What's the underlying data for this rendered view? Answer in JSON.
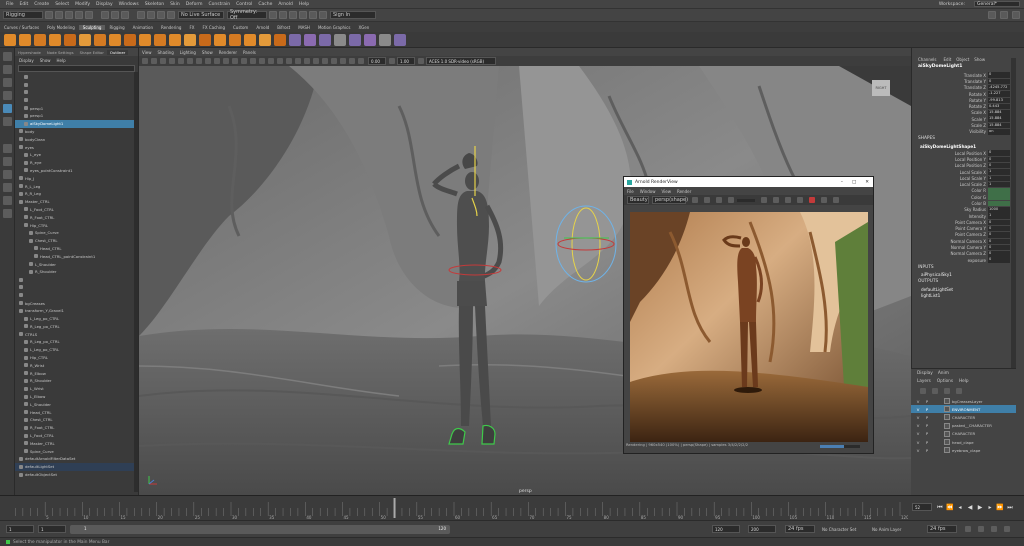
{
  "menu": {
    "items": [
      "File",
      "Edit",
      "Create",
      "Select",
      "Modify",
      "Display",
      "Windows",
      "Skeleton",
      "Skin",
      "Deform",
      "Constrain",
      "Control",
      "Cache",
      "Arnold",
      "Help"
    ],
    "workspace_label": "Workspace:",
    "workspace_value": "General*"
  },
  "statusline": {
    "mode": "Rigging",
    "live_surface": "No Live Surface",
    "symmetry": "Symmetry: Off",
    "signin": "Sign In"
  },
  "shelf_tabs": [
    "Curves / Surfaces",
    "Poly Modeling",
    "Sculpting",
    "Rigging",
    "Animation",
    "Rendering",
    "FX",
    "FX Caching",
    "Custom",
    "Arnold",
    "Bifrost",
    "MASH",
    "Motion Graphics",
    "XGen"
  ],
  "shelf_active": "Sculpting",
  "outliner": {
    "tabs": [
      "Hypershade",
      "Node Settings",
      "Shape Editor",
      "Outliner"
    ],
    "menu": [
      "Display",
      "Show",
      "Help"
    ],
    "search_placeholder": "",
    "items": [
      {
        "label": "",
        "level": 1
      },
      {
        "label": "",
        "level": 1
      },
      {
        "label": "",
        "level": 1
      },
      {
        "label": "",
        "level": 1
      },
      {
        "label": "persp1",
        "level": 1
      },
      {
        "label": "persp1",
        "level": 1
      },
      {
        "label": "aiSkyDomeLight1",
        "level": 1,
        "sel": true
      },
      {
        "label": "body",
        "level": 0
      },
      {
        "label": "bodyClean",
        "level": 0
      },
      {
        "label": "eyes",
        "level": 0
      },
      {
        "label": "L_eye",
        "level": 1
      },
      {
        "label": "R_eye",
        "level": 1
      },
      {
        "label": "eyes_pointConstraint1",
        "level": 1
      },
      {
        "label": "Hip_J",
        "level": 0
      },
      {
        "label": "R_L_Leg",
        "level": 0
      },
      {
        "label": "R_R_Leg",
        "level": 0
      },
      {
        "label": "Master_CTRL",
        "level": 0
      },
      {
        "label": "L_Foot_CTRL",
        "level": 1
      },
      {
        "label": "R_Foot_CTRL",
        "level": 1
      },
      {
        "label": "Hip_CTRL",
        "level": 1
      },
      {
        "label": "Spine_Curve",
        "level": 2
      },
      {
        "label": "Chest_CTRL",
        "level": 2
      },
      {
        "label": "Head_CTRL",
        "level": 3
      },
      {
        "label": "Head_CTRL_pointConstraint1",
        "level": 3
      },
      {
        "label": "L_Shoulder",
        "level": 2
      },
      {
        "label": "R_Shoulder",
        "level": 2
      },
      {
        "label": "",
        "level": 0
      },
      {
        "label": "",
        "level": 0
      },
      {
        "label": "",
        "level": 0
      },
      {
        "label": "bgCreases",
        "level": 0
      },
      {
        "label": "transform_Y,Gravel1",
        "level": 0
      },
      {
        "label": "L_Leg_po_CTRL",
        "level": 1
      },
      {
        "label": "R_Leg_po_CTRL",
        "level": 1
      },
      {
        "label": "CTRLS",
        "level": 0
      },
      {
        "label": "R_Leg_po_CTRL",
        "level": 1
      },
      {
        "label": "L_Leg_po_CTRL",
        "level": 1
      },
      {
        "label": "Hip_CTRL",
        "level": 1
      },
      {
        "label": "R_Wrist",
        "level": 1
      },
      {
        "label": "R_Elbow",
        "level": 1
      },
      {
        "label": "R_Shoulder",
        "level": 1
      },
      {
        "label": "L_Wrist",
        "level": 1
      },
      {
        "label": "L_Elbow",
        "level": 1
      },
      {
        "label": "L_Shoulder",
        "level": 1
      },
      {
        "label": "Head_CTRL",
        "level": 1
      },
      {
        "label": "Chest_CTRL",
        "level": 1
      },
      {
        "label": "R_Foot_CTRL",
        "level": 1
      },
      {
        "label": "L_Foot_CTRL",
        "level": 1
      },
      {
        "label": "Master_CTRL",
        "level": 1
      },
      {
        "label": "Spine_Curve",
        "level": 1
      },
      {
        "label": "defaultArnoldFilterDataSet",
        "level": 0
      },
      {
        "label": "defaultLightSet",
        "level": 0,
        "hl": true
      },
      {
        "label": "defaultObjectSet",
        "level": 0
      }
    ]
  },
  "viewport": {
    "menu": [
      "View",
      "Shading",
      "Lighting",
      "Show",
      "Renderer",
      "Panels"
    ],
    "exposure": "0.00",
    "gamma": "1.00",
    "colorspace": "ACES 1.0 SDR-video (sRGB)",
    "camera_label": "persp",
    "viewcube_label": "RIGHT"
  },
  "renderview": {
    "title": "Arnold RenderView",
    "menu": [
      "File",
      "Window",
      "View",
      "Render"
    ],
    "aov": "Beauty",
    "camera": "persp(shape)",
    "status": "Rendering | 960x540 (100%) | persp(Shape) | samples 3/4/2/2/2/2"
  },
  "channelbox": {
    "menu": [
      "Channels",
      "Edit",
      "Object",
      "Show"
    ],
    "object": "aiSkyDomeLight1",
    "attrs": [
      {
        "name": "Translate X",
        "value": "0"
      },
      {
        "name": "Translate Y",
        "value": "0"
      },
      {
        "name": "Translate Z",
        "value": "-4245.772"
      },
      {
        "name": "Rotate X",
        "value": "-1.227"
      },
      {
        "name": "Rotate Y",
        "value": "-99.813"
      },
      {
        "name": "Rotate Z",
        "value": "0.443"
      },
      {
        "name": "Scale X",
        "value": "15.884"
      },
      {
        "name": "Scale Y",
        "value": "15.884"
      },
      {
        "name": "Scale Z",
        "value": "15.884"
      },
      {
        "name": "Visibility",
        "value": "on"
      }
    ],
    "shapes_label": "SHAPES",
    "shape_name": "aiSkyDomeLightShape1",
    "shape_attrs": [
      {
        "name": "Local Position X",
        "value": "0"
      },
      {
        "name": "Local Position Y",
        "value": "0"
      },
      {
        "name": "Local Position Z",
        "value": "0"
      },
      {
        "name": "Local Scale X",
        "value": "1"
      },
      {
        "name": "Local Scale Y",
        "value": "1"
      },
      {
        "name": "Local Scale Z",
        "value": "1"
      },
      {
        "name": "Color R",
        "value": "",
        "g": true
      },
      {
        "name": "Color G",
        "value": "",
        "g": true
      },
      {
        "name": "Color B",
        "value": "",
        "g": true
      },
      {
        "name": "Sky Radius",
        "value": "1000"
      },
      {
        "name": "Intensity",
        "value": "1"
      },
      {
        "name": "Point Camera X",
        "value": "0"
      },
      {
        "name": "Point Camera Y",
        "value": "0"
      },
      {
        "name": "Point Camera Z",
        "value": "0"
      },
      {
        "name": "Normal Camera X",
        "value": "0"
      },
      {
        "name": "Normal Camera Y",
        "value": "0"
      },
      {
        "name": "Normal Camera Z",
        "value": "0"
      },
      {
        "name": "exposure",
        "value": "0"
      }
    ],
    "inputs_label": "INPUTS",
    "inputs": [
      "aiPhysicalSky1"
    ],
    "outputs_label": "OUTPUTS",
    "outputs": [
      "defaultLightSet",
      "lightList1"
    ]
  },
  "layers": {
    "tabs": [
      "Display",
      "Anim"
    ],
    "menu": [
      "Layers",
      "Options",
      "Help"
    ],
    "rows": [
      {
        "v": "V",
        "p": "P",
        "name": "bgCreasesLayer"
      },
      {
        "v": "V",
        "p": "P",
        "name": "ENVIRONMENT",
        "sel": true
      },
      {
        "v": "V",
        "p": "P",
        "name": "CHARACTER"
      },
      {
        "v": "V",
        "p": "P",
        "name": "pasted__CHARACTER"
      },
      {
        "v": "V",
        "p": "P",
        "name": "CHARACTER"
      },
      {
        "v": "V",
        "p": "P",
        "name": "head_clape"
      },
      {
        "v": "V",
        "p": "P",
        "name": "eyebrow_clape"
      }
    ]
  },
  "timeline": {
    "current_frame": "52",
    "ticks": [
      "5",
      "10",
      "15",
      "20",
      "25",
      "30",
      "35",
      "40",
      "45",
      "50",
      "55",
      "60",
      "65",
      "70",
      "75",
      "80",
      "85",
      "90",
      "95",
      "100",
      "105",
      "110",
      "115",
      "120"
    ]
  },
  "range": {
    "start": "1",
    "inner_start": "1",
    "slider_end": "120",
    "end_label": "120",
    "end": "120",
    "anim_end": "200",
    "fps": "24 fps",
    "char_set": "No Character Set",
    "anim_layer": "No Anim Layer"
  },
  "help": {
    "text": "Select the manipulator in the Main Menu Bar"
  }
}
